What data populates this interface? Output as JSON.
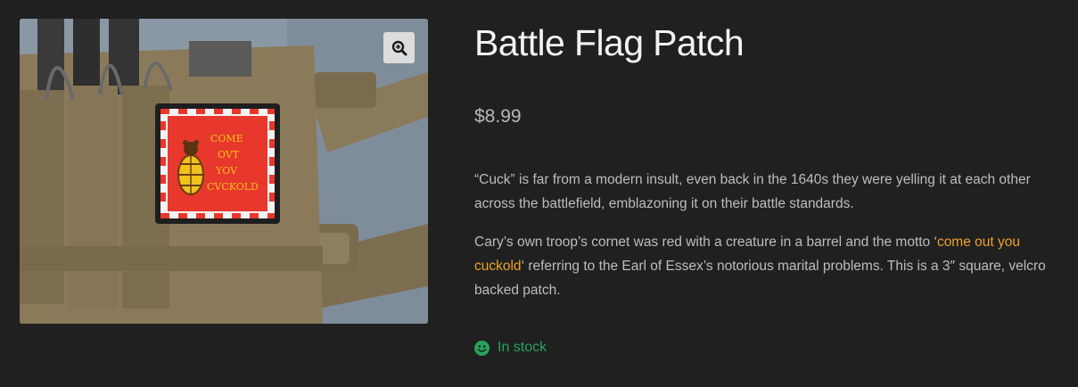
{
  "product": {
    "title": "Battle Flag Patch",
    "price": "$8.99",
    "description": {
      "paragraph1": "“Cuck” is far from a modern insult, even back in the 1640s they were yelling it at each other across the battlefield, emblazoning it on their battle standards.",
      "paragraph2_before": "Cary’s own troop’s cornet was red with a creature in a barrel and the motto ‘",
      "paragraph2_link": "come out you cuckold",
      "paragraph2_after": "‘ referring to the Earl of Essex’s notorious marital problems. This is a 3″ square, velcro backed patch."
    },
    "stock_status": "In stock"
  },
  "gallery": {
    "patch_text": [
      "COME",
      "OVT",
      "YOV",
      "CVCKOLD"
    ],
    "zoom_icon": "magnify-plus-icon"
  },
  "colors": {
    "background": "#202020",
    "link": "#eea22c",
    "in_stock": "#27a35a",
    "patch_red": "#e8372c",
    "patch_text": "#f0c21c"
  }
}
